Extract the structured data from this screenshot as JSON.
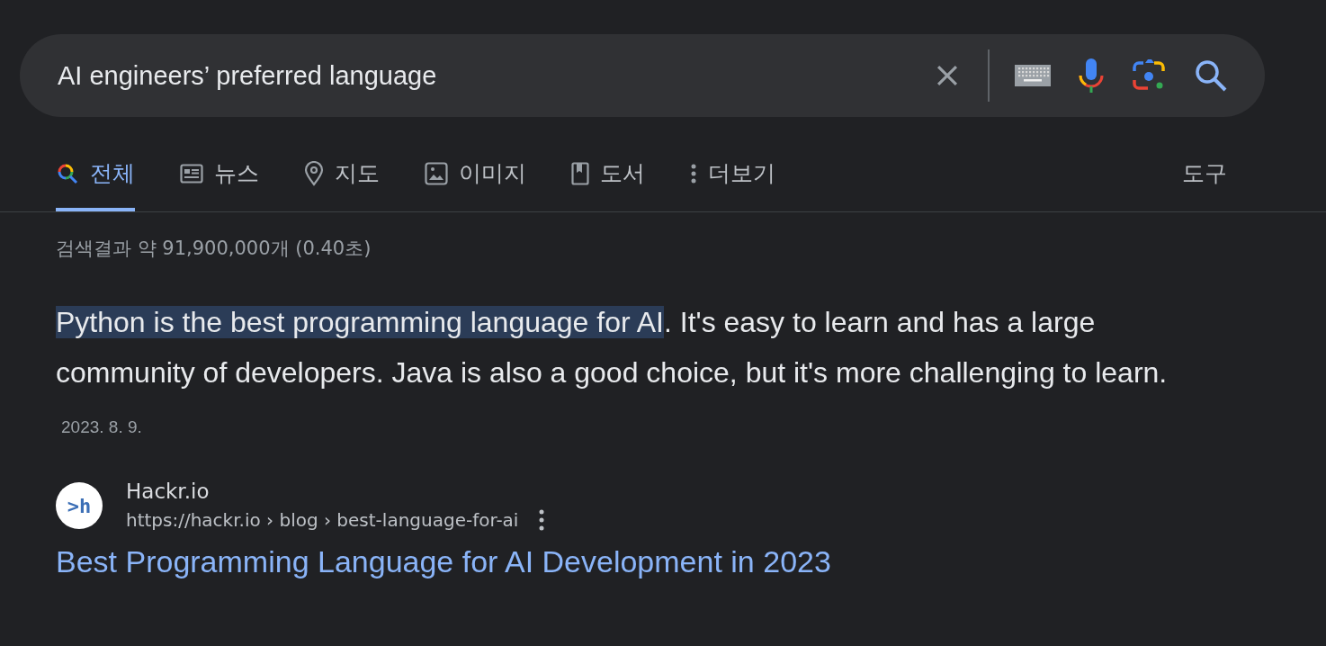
{
  "search": {
    "value": "AI engineers’ preferred language"
  },
  "tabs": [
    {
      "label": "전체",
      "kind": "all",
      "selected": true
    },
    {
      "label": "뉴스",
      "kind": "news",
      "selected": false
    },
    {
      "label": "지도",
      "kind": "maps",
      "selected": false
    },
    {
      "label": "이미지",
      "kind": "images",
      "selected": false
    },
    {
      "label": "도서",
      "kind": "books",
      "selected": false
    },
    {
      "label": "더보기",
      "kind": "more",
      "selected": false
    }
  ],
  "tools": "도구",
  "result_stats": "검색결과 약 91,900,000개 (0.40초)",
  "snippet": {
    "highlight": "Python is the best programming language for AI",
    "text": ". It's easy to learn and has a large community of developers. Java is also a good choice, but it's more challenging to learn.",
    "date": "2023. 8. 9."
  },
  "source": {
    "favicon": ">h",
    "site": "Hackr.io",
    "url": "https://hackr.io › blog › best-language-for-ai",
    "title": "Best Programming Language for AI Development in 2023"
  }
}
